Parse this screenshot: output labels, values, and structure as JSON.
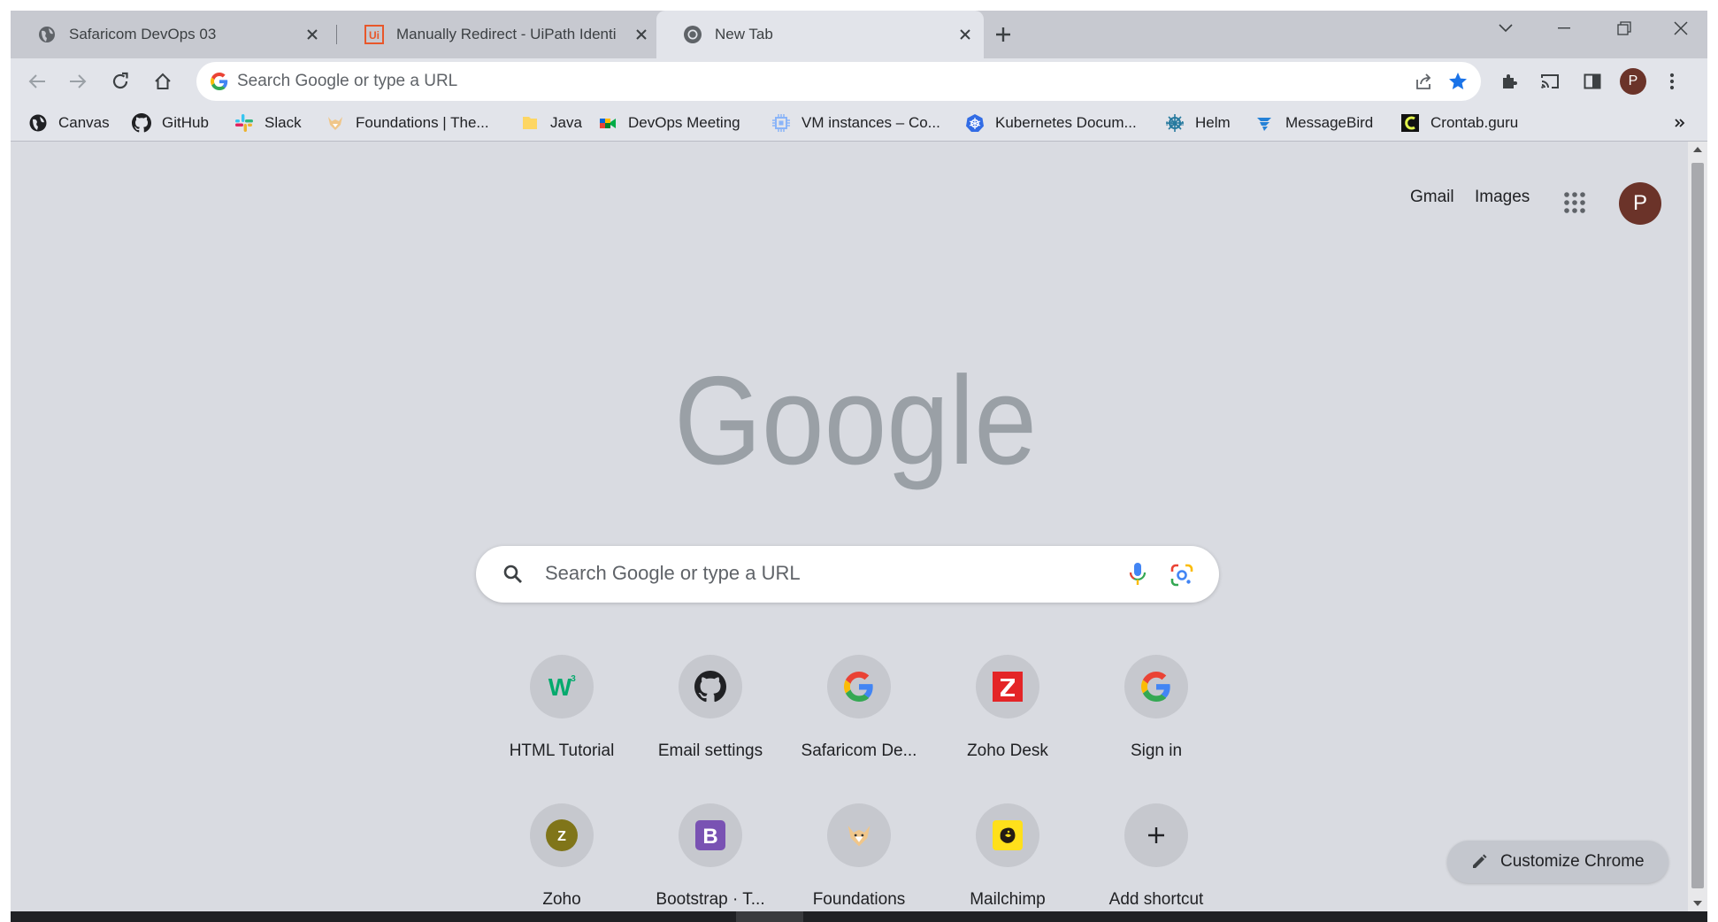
{
  "tabs": [
    {
      "title": "Safaricom DevOps 03",
      "icon": "globe-icon"
    },
    {
      "title": "Manually Redirect - UiPath Identi",
      "icon": "uipath-icon"
    },
    {
      "title": "New Tab",
      "icon": "chrome-icon"
    }
  ],
  "omnibox": {
    "placeholder": "Search Google or type a URL"
  },
  "bookmarks": [
    {
      "label": "Canvas",
      "icon": "globe-icon"
    },
    {
      "label": "GitHub",
      "icon": "github-icon"
    },
    {
      "label": "Slack",
      "icon": "slack-icon"
    },
    {
      "label": "Foundations | The...",
      "icon": "fox-icon"
    },
    {
      "label": "Java",
      "icon": "folder-icon"
    },
    {
      "label": "DevOps Meeting",
      "icon": "meet-icon"
    },
    {
      "label": "VM instances – Co...",
      "icon": "chip-icon"
    },
    {
      "label": "Kubernetes Docum...",
      "icon": "kubernetes-icon"
    },
    {
      "label": "Helm",
      "icon": "helm-icon"
    },
    {
      "label": "MessageBird",
      "icon": "messagebird-icon"
    },
    {
      "label": "Crontab.guru",
      "icon": "crontab-icon"
    }
  ],
  "header_links": {
    "gmail": "Gmail",
    "images": "Images"
  },
  "profile_initial": "P",
  "search": {
    "placeholder": "Search Google or type a URL"
  },
  "shortcuts": [
    {
      "label": "HTML Tutorial",
      "icon": "w3schools-icon"
    },
    {
      "label": "Email settings",
      "icon": "github-icon"
    },
    {
      "label": "Safaricom De...",
      "icon": "google-icon"
    },
    {
      "label": "Zoho Desk",
      "icon": "zoho-desk-icon"
    },
    {
      "label": "Sign in",
      "icon": "google-icon"
    },
    {
      "label": "Zoho",
      "icon": "zoho-icon"
    },
    {
      "label": "Bootstrap · T...",
      "icon": "bootstrap-icon"
    },
    {
      "label": "Foundations",
      "icon": "fox-icon"
    },
    {
      "label": "Mailchimp",
      "icon": "mailchimp-icon"
    },
    {
      "label": "Add shortcut",
      "icon": "plus-icon"
    }
  ],
  "customize": {
    "label": "Customize Chrome"
  },
  "colors": {
    "google_logo": "#9aa0a6",
    "bookmark_star": "#1a73e8",
    "avatar": "#6b3329"
  }
}
